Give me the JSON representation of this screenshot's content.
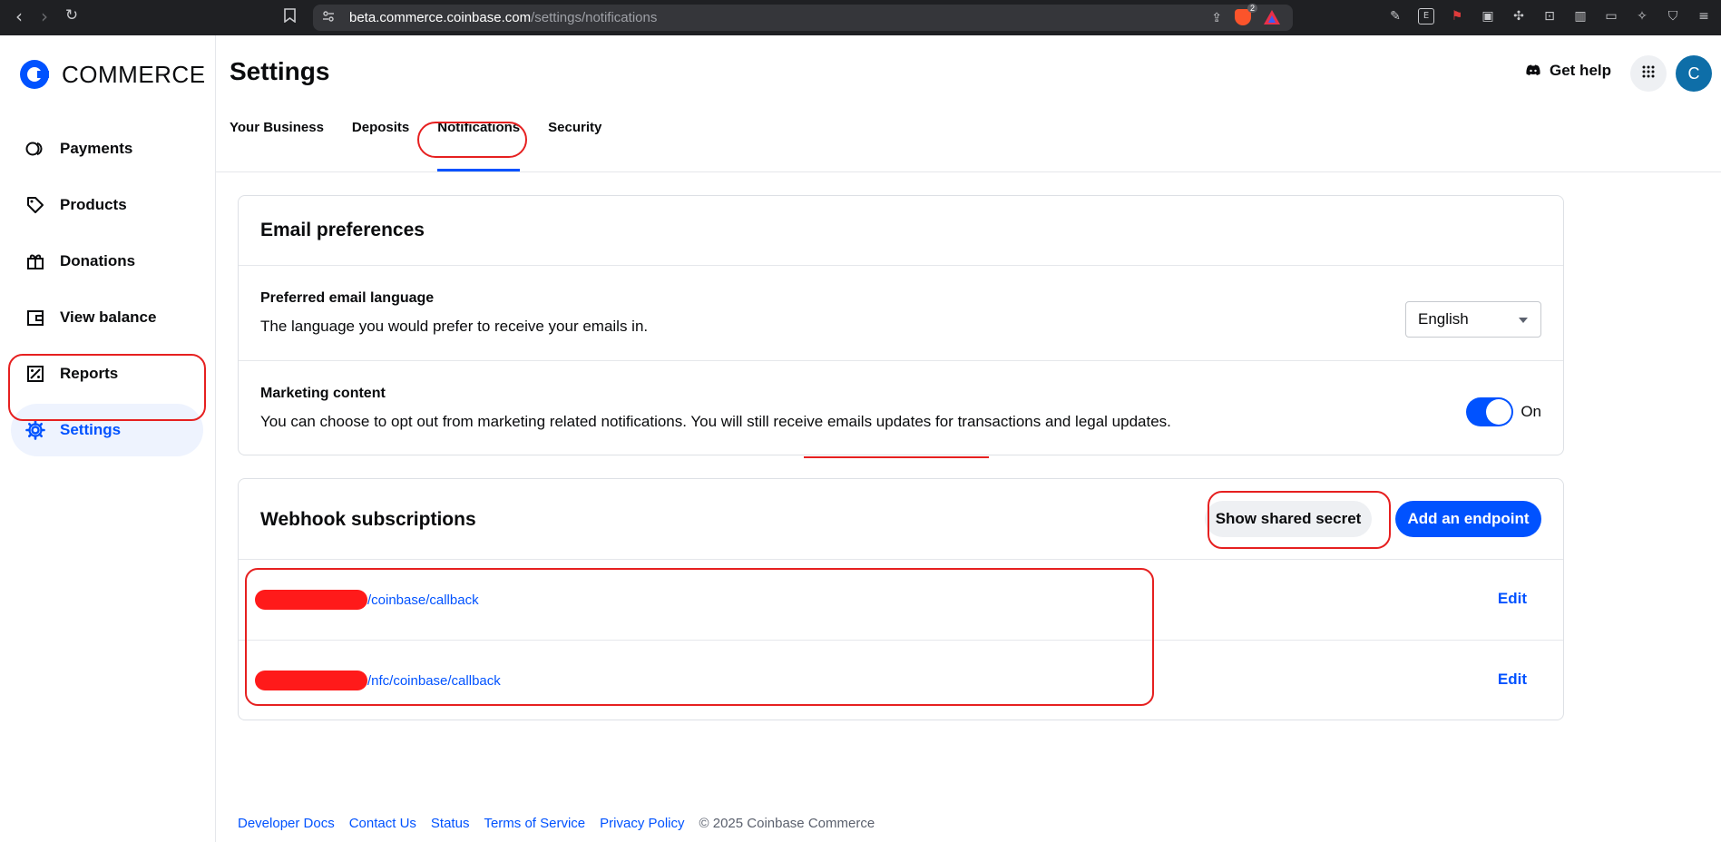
{
  "browser": {
    "url_host": "beta.commerce.coinbase.com",
    "url_path": "/settings/notifications",
    "brave_badge": "2"
  },
  "brand": {
    "name": "COMMERCE",
    "accent": "#0052ff"
  },
  "sidebar": {
    "items": [
      {
        "label": "Payments",
        "icon": "payments-icon"
      },
      {
        "label": "Products",
        "icon": "tag-icon"
      },
      {
        "label": "Donations",
        "icon": "gift-icon"
      },
      {
        "label": "View balance",
        "icon": "wallet-icon"
      },
      {
        "label": "Reports",
        "icon": "reports-icon"
      },
      {
        "label": "Settings",
        "icon": "gear-icon",
        "active": true
      }
    ]
  },
  "header": {
    "title": "Settings",
    "help_label": "Get help",
    "avatar_initial": "C"
  },
  "tabs": [
    {
      "label": "Your Business"
    },
    {
      "label": "Deposits"
    },
    {
      "label": "Notifications",
      "active": true
    },
    {
      "label": "Security"
    }
  ],
  "email_preferences": {
    "title": "Email preferences",
    "language": {
      "title": "Preferred email language",
      "description": "The language you would prefer to receive your emails in.",
      "selected": "English"
    },
    "marketing": {
      "title": "Marketing content",
      "description": "You can choose to opt out from marketing related notifications. You will still receive emails updates for transactions and legal updates.",
      "toggle_label": "On",
      "enabled": true
    }
  },
  "webhooks": {
    "title": "Webhook subscriptions",
    "show_secret_label": "Show shared secret",
    "add_endpoint_label": "Add an endpoint",
    "endpoints": [
      {
        "path": "/coinbase/callback",
        "edit_label": "Edit"
      },
      {
        "path": "/nfc/coinbase/callback",
        "edit_label": "Edit"
      }
    ]
  },
  "footer": {
    "links": [
      "Developer Docs",
      "Contact Us",
      "Status",
      "Terms of Service",
      "Privacy Policy"
    ],
    "copyright": "© 2025 Coinbase Commerce"
  }
}
